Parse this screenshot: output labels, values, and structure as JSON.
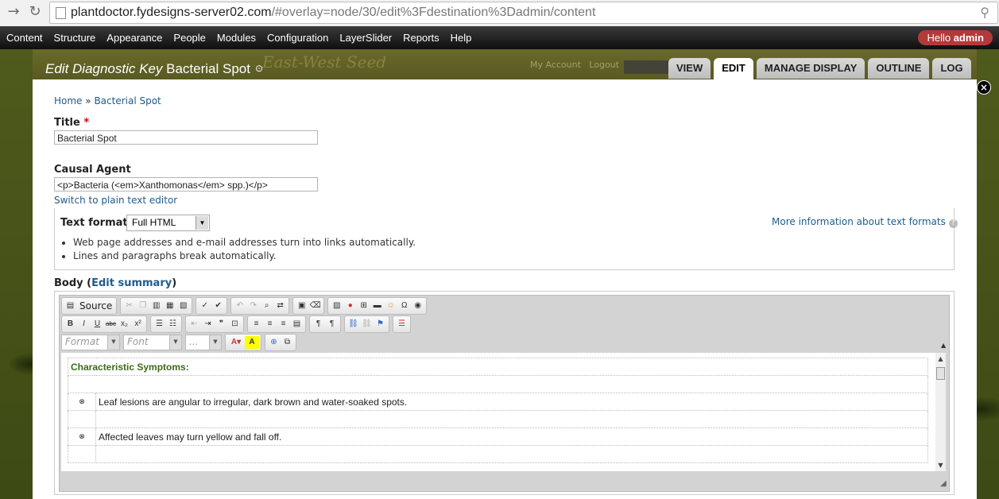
{
  "browser": {
    "url_host": "plantdoctor.fydesigns-server02.com",
    "url_path": "/#overlay=node/30/edit%3Fdestination%3Dadmin/content"
  },
  "admin_menu": {
    "items": [
      "Content",
      "Structure",
      "Appearance",
      "People",
      "Modules",
      "Configuration",
      "LayerSlider",
      "Reports",
      "Help"
    ],
    "hello_prefix": "Hello ",
    "hello_user": "admin"
  },
  "backdrop": {
    "logo_text": "East-West Seed",
    "my_account": "My Account",
    "logout": "Logout"
  },
  "overlay": {
    "title_prefix": "Edit Diagnostic Key",
    "title_node": "Bacterial Spot",
    "tabs": [
      "VIEW",
      "EDIT",
      "MANAGE DISPLAY",
      "OUTLINE",
      "LOG"
    ],
    "active_tab": "EDIT"
  },
  "breadcrumb": {
    "home": "Home",
    "sep": "»",
    "current": "Bacterial Spot"
  },
  "form": {
    "title_label": "Title",
    "required_mark": "*",
    "title_value": "Bacterial Spot",
    "causal_label": "Causal Agent",
    "causal_value": "<p>Bacteria (<em>Xanthomonas</em> spp.)</p>",
    "switch_link": "Switch to plain text editor",
    "text_format_label": "Text format",
    "text_format_value": "Full HTML",
    "more_info": "More information about text formats",
    "tips": [
      "Web page addresses and e-mail addresses turn into links automatically.",
      "Lines and paragraphs break automatically."
    ],
    "body_label": "Body",
    "edit_summary": "Edit summary"
  },
  "editor": {
    "source_label": "Source",
    "format_placeholder": "Format",
    "font_placeholder": "Font",
    "size_placeholder": "...",
    "heading": "Characteristic Symptoms:",
    "rows": [
      "Leaf lesions are angular to irregular, dark brown and water-soaked spots.",
      "Affected leaves may turn yellow and fall off."
    ]
  },
  "colors": {
    "accent_link": "#1e5c8b",
    "hello_badge": "#b23a3a",
    "heading_green": "#3b6a1a"
  }
}
